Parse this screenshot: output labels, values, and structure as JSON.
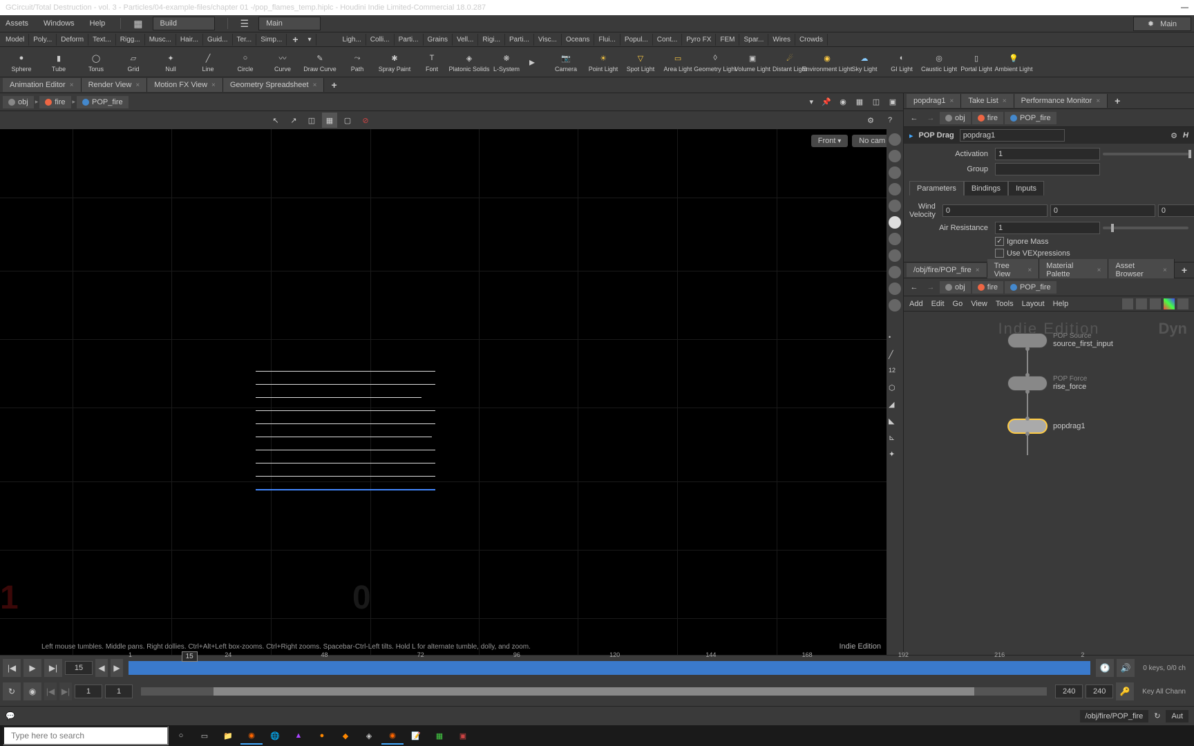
{
  "title": "GCircuit/Total Destruction - vol. 3 - Particles/04-example-files/chapter 01 -/pop_flames_temp.hiplc - Houdini Indie Limited-Commercial 18.0.287",
  "menus": [
    "Assets",
    "Windows",
    "Help"
  ],
  "desktop": {
    "label": "Build"
  },
  "main_menu_label": "Main",
  "right_main_label": "Main",
  "shelves": [
    "Model",
    "Poly...",
    "Deform",
    "Text...",
    "Rigg...",
    "Musc...",
    "Hair...",
    "Guid...",
    "Ter...",
    "Simp..."
  ],
  "shelves2": [
    "Ligh...",
    "Colli...",
    "Parti...",
    "Grains",
    "Vell...",
    "Rigi...",
    "Parti...",
    "Visc...",
    "Oceans",
    "Flui...",
    "Popul...",
    "Cont...",
    "Pyro FX",
    "FEM",
    "Spar...",
    "Wires",
    "Crowds"
  ],
  "tools": [
    {
      "name": "sphere",
      "label": "Sphere"
    },
    {
      "name": "tube",
      "label": "Tube"
    },
    {
      "name": "torus",
      "label": "Torus"
    },
    {
      "name": "grid",
      "label": "Grid"
    },
    {
      "name": "null",
      "label": "Null"
    },
    {
      "name": "line",
      "label": "Line"
    },
    {
      "name": "circle",
      "label": "Circle"
    },
    {
      "name": "curve",
      "label": "Curve"
    },
    {
      "name": "drawcurve",
      "label": "Draw Curve"
    },
    {
      "name": "path",
      "label": "Path"
    },
    {
      "name": "spraypaint",
      "label": "Spray Paint"
    },
    {
      "name": "font",
      "label": "Font"
    },
    {
      "name": "platonic",
      "label": "Platonic Solids"
    },
    {
      "name": "lsystem",
      "label": "L-System"
    }
  ],
  "tools2": [
    {
      "name": "camera",
      "label": "Camera"
    },
    {
      "name": "pointlight",
      "label": "Point Light"
    },
    {
      "name": "spotlight",
      "label": "Spot Light"
    },
    {
      "name": "arealight",
      "label": "Area Light"
    },
    {
      "name": "geometrylight",
      "label": "Geometry Light"
    },
    {
      "name": "volumelight",
      "label": "Volume Light"
    },
    {
      "name": "distantlight",
      "label": "Distant Light"
    },
    {
      "name": "envlight",
      "label": "Environment Light"
    },
    {
      "name": "skylight",
      "label": "Sky Light"
    },
    {
      "name": "gilight",
      "label": "GI Light"
    },
    {
      "name": "causticlight",
      "label": "Caustic Light"
    },
    {
      "name": "portallight",
      "label": "Portal Light"
    },
    {
      "name": "ambientlight",
      "label": "Ambient Light"
    }
  ],
  "viewport_tabs": [
    "Animation Editor",
    "Render View",
    "Motion FX View",
    "Geometry Spreadsheet"
  ],
  "breadcrumb": [
    {
      "label": "obj",
      "color": "#888"
    },
    {
      "label": "fire",
      "color": "#e64"
    },
    {
      "label": "POP_fire",
      "color": "#48c"
    }
  ],
  "viewport": {
    "view_dd": "Front",
    "cam_dd": "No cam",
    "hint": "Left mouse tumbles. Middle pans. Right dollies. Ctrl+Alt+Left box-zooms. Ctrl+Right zooms. Spacebar-Ctrl-Left tilts. Hold L for alternate tumble, dolly, and zoom.",
    "edition": "Indie Edition"
  },
  "param_pane": {
    "tabs": [
      "popdrag1",
      "Take List",
      "Performance Monitor"
    ],
    "node_type": "POP Drag",
    "node_name": "popdrag1",
    "activation_label": "Activation",
    "activation_val": "1",
    "group_label": "Group",
    "group_val": "",
    "ptabs": [
      "Parameters",
      "Bindings",
      "Inputs"
    ],
    "wind_label": "Wind Velocity",
    "wind_x": "0",
    "wind_y": "0",
    "wind_z": "0",
    "air_label": "Air Resistance",
    "air_val": "1",
    "ignore_mass": "Ignore Mass",
    "vex": "Use VEXpressions"
  },
  "network": {
    "tabs": [
      "/obj/fire/POP_fire",
      "Tree View",
      "Material Palette",
      "Asset Browser"
    ],
    "menus": [
      "Add",
      "Edit",
      "Go",
      "View",
      "Tools",
      "Layout",
      "Help"
    ],
    "watermark": "Indie Edition",
    "watermark2": "Dyn",
    "nodes": [
      {
        "type": "POP Source",
        "label": "source_first_input"
      },
      {
        "type": "POP Force",
        "label": "rise_force"
      },
      {
        "type": "",
        "label": "popdrag1",
        "selected": true
      }
    ]
  },
  "timeline": {
    "current": "15",
    "marker": "15",
    "ticks": [
      "1",
      "24",
      "48",
      "72",
      "96",
      "120",
      "144",
      "168",
      "192",
      "216",
      "2"
    ],
    "start": "1",
    "start2": "1",
    "end": "240",
    "end2": "240",
    "keys": "0 keys, 0/0 ch",
    "keyall": "Key All Chann"
  },
  "status": {
    "path": "/obj/fire/POP_fire",
    "auto": "Aut"
  },
  "taskbar": {
    "search": "Type here to search"
  }
}
